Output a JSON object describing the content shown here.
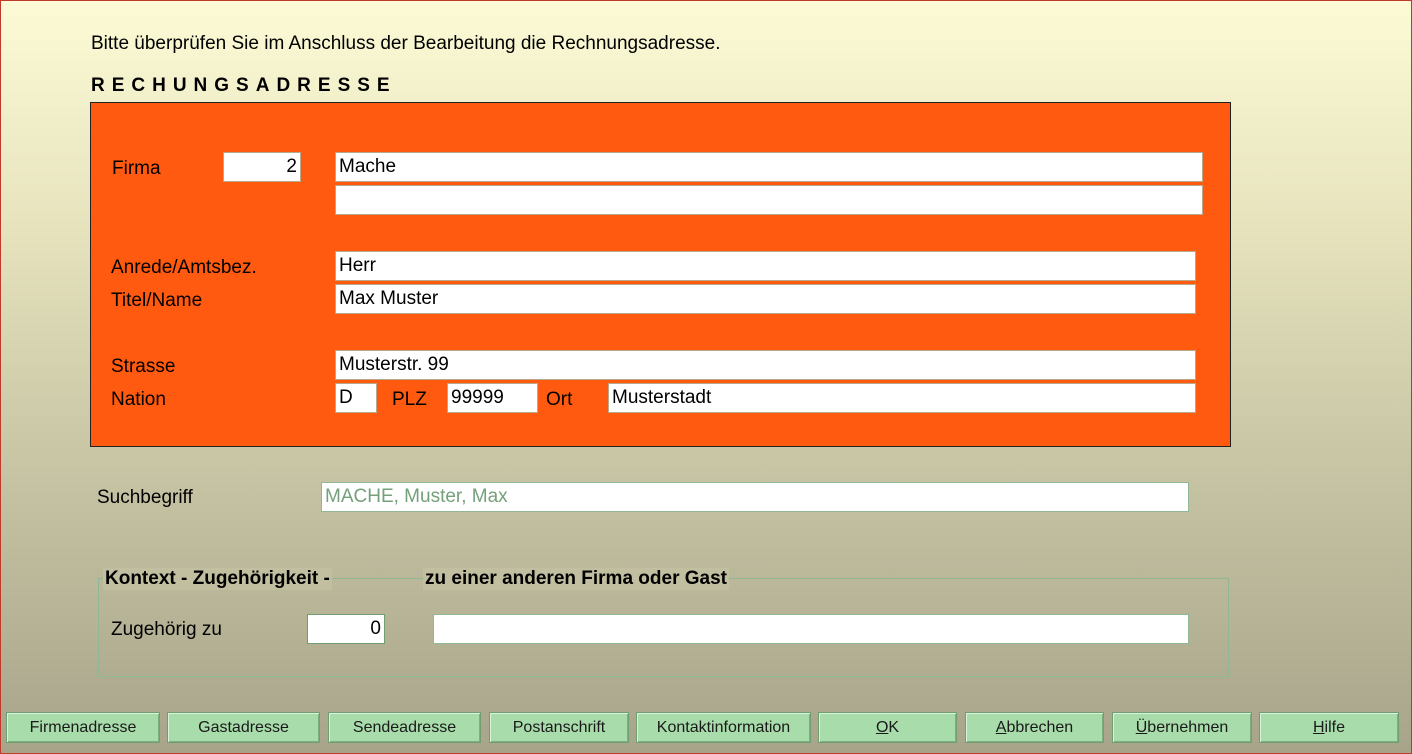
{
  "intro_text": "Bitte überprüfen Sie im Anschluss der Bearbeitung die Rechnungsadresse.",
  "section_heading": "RECHUNGSADRESSE",
  "address": {
    "firma_label": "Firma",
    "firma_number": "2",
    "firma_name1": "Mache",
    "firma_name2": "",
    "anrede_label": "Anrede/Amtsbez.",
    "anrede_value": "Herr",
    "titel_label": "Titel/Name",
    "titel_value": "Max Muster",
    "strasse_label": "Strasse",
    "strasse_value": "Musterstr. 99",
    "nation_label": "Nation",
    "nation_value": "D",
    "plz_label": "PLZ",
    "plz_value": "99999",
    "ort_label": "Ort",
    "ort_value": "Musterstadt"
  },
  "search": {
    "label": "Suchbegriff",
    "value": "MACHE, Muster, Max"
  },
  "context": {
    "legend_left": "Kontext - Zugehörigkeit -",
    "legend_right": "zu einer anderen Firma oder Gast",
    "label": "Zugehörig zu",
    "number": "0",
    "name": ""
  },
  "buttons": {
    "firmenadresse": "Firmenadresse",
    "gastadresse": "Gastadresse",
    "sendeadresse": "Sendeadresse",
    "postanschrift": "Postanschrift",
    "kontaktinformation": "Kontaktinformation",
    "ok_mnemonic": "O",
    "ok_rest": "K",
    "abbrechen_mnemonic": "A",
    "abbrechen_rest": "bbrechen",
    "uebernehmen_mnemonic": "Ü",
    "uebernehmen_rest": "bernehmen",
    "hilfe_mnemonic": "H",
    "hilfe_rest": "ilfe"
  },
  "colors": {
    "panel_orange": "#ff5a10",
    "button_green": "#a8dcaa"
  }
}
